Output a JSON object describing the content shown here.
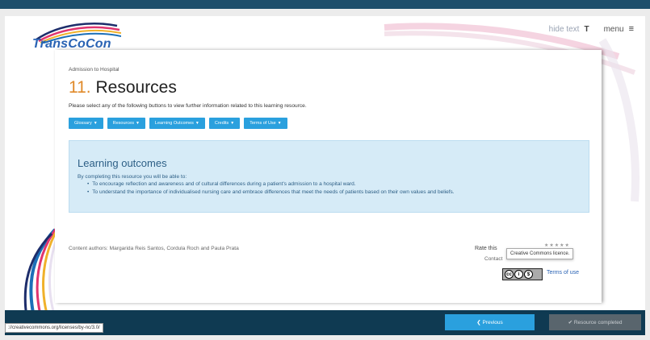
{
  "header": {
    "logo_text": "TransCoCon",
    "hide_text_label": "hide text",
    "hide_text_icon": "T",
    "menu_label": "menu",
    "menu_icon": "≡"
  },
  "page": {
    "breadcrumb": "Admission to Hospital",
    "title_number": "11.",
    "title_text": "Resources",
    "intro": "Please select any of the following buttons to view further information related to this learning resource."
  },
  "resource_buttons": [
    {
      "label": "Glossary"
    },
    {
      "label": "Resources"
    },
    {
      "label": "Learning Outcomes"
    },
    {
      "label": "Credits"
    },
    {
      "label": "Terms of Use"
    }
  ],
  "learning_outcomes": {
    "title": "Learning outcomes",
    "lead": "By completing this resource you will be able to:",
    "items": [
      "To encourage reflection and awareness and of cultural differences during a patient's admission to a hospital ward.",
      "To understand the importance of individualised nursing care and embrace differences that meet the needs of patients based on their own values and beliefs."
    ]
  },
  "footer": {
    "authors": "Content authors: Margarida Reis Santos, Cordula Roch and Paula Prata",
    "rate_label": "Rate this",
    "stars_text": "★★★★★",
    "contact_label": "Contact",
    "tooltip": "Creative Commons licence.",
    "terms_label": "Terms of use",
    "status_url": "://creativecommons.org/licenses/by-nc/3.0/"
  },
  "nav": {
    "previous_label": "❮ Previous",
    "complete_label": "✔ Resource completed"
  },
  "colors": {
    "accent_blue": "#2aa0de",
    "title_orange": "#e08a2a",
    "bar_dark": "#0f3a52",
    "panel_blue": "#d6ebf7"
  }
}
